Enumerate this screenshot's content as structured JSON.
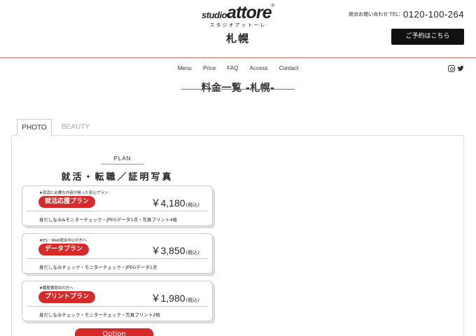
{
  "header": {
    "logo_studio": "studio",
    "logo_attore": "attore",
    "logo_reg": "®",
    "logo_kana": "スタジオアットーレ",
    "city": "札幌",
    "contact_label": "総合お問い合わせ TEL：",
    "tel": "0120-100-264",
    "reserve_label": "ご予約はこちら"
  },
  "nav": {
    "items": [
      "Menu",
      "Price",
      "FAQ",
      "Access",
      "Contact"
    ]
  },
  "social": {
    "icons": [
      "instagram-icon",
      "twitter-icon"
    ]
  },
  "page": {
    "title": "料金一覧 -札幌-"
  },
  "tabs": {
    "active": "PHOTO",
    "inactive": "BEAUTY"
  },
  "plan": {
    "label": "PLAN",
    "heading": "就活・転職／証明写真",
    "cards": [
      {
        "sub": "★就活に必要な内容が揃った安心プラン",
        "badge": "就活応援プラン",
        "price": "￥4,180",
        "tax": "(税込)",
        "desc": "身だしなみ&モニターチェック・JPEGデータ1点・写真プリント4枚"
      },
      {
        "sub": "★ES・Web提出中心の方へ",
        "badge": "データプラン",
        "price": "￥3,850",
        "tax": "(税込)",
        "desc": "身だしなみチェック・モニターチェック・JPEGデータ1点"
      },
      {
        "sub": "★履歴書提出の方へ",
        "badge": "プリントプラン",
        "price": "￥1,980",
        "tax": "(税込)",
        "desc": "身だしなみチェック・モニターチェック・写真プリント2枚"
      }
    ],
    "option_label": "Option"
  },
  "colors": {
    "accent": "#d62a2a",
    "rule": "#d36a6a",
    "button_dark": "#111111"
  }
}
